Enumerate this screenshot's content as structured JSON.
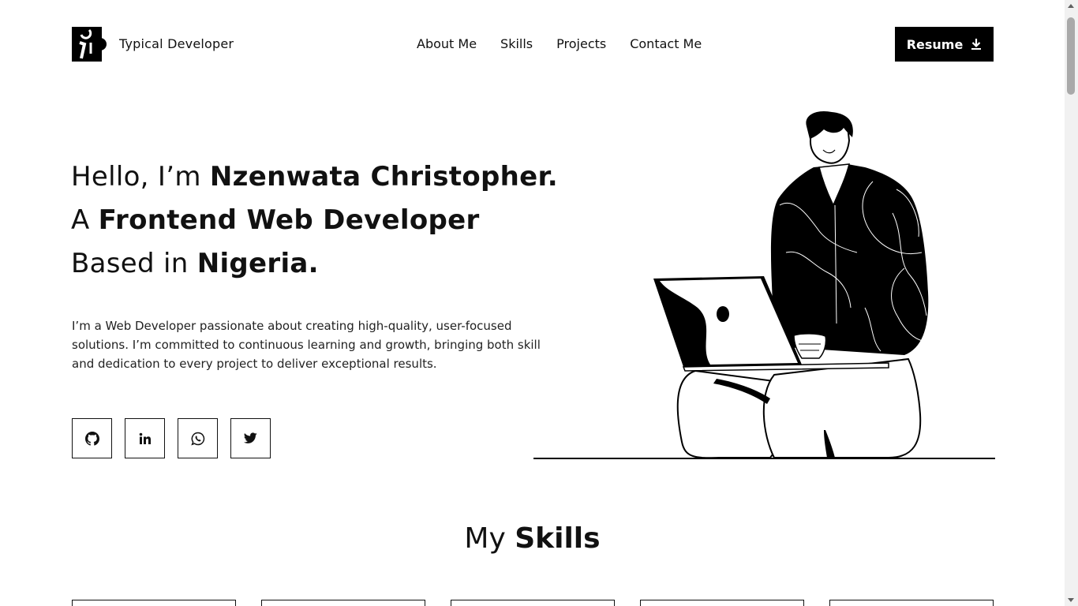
{
  "header": {
    "brand": "Typical Developer",
    "nav": [
      "About Me",
      "Skills",
      "Projects",
      "Contact Me"
    ],
    "resume_label": "Resume"
  },
  "hero": {
    "line1_pre": "Hello, I’m ",
    "line1_bold": "Nzenwata Christopher.",
    "line2_pre": "A ",
    "line2_bold": "Frontend Web Developer",
    "line3_pre": "Based in ",
    "line3_bold": "Nigeria.",
    "intro": "I’m a Web Developer passionate about creating high-quality, user-focused solutions. I’m committed to continuous learning and growth, bringing both skill and dedication to every project to deliver exceptional results."
  },
  "socials": [
    {
      "icon": "github-icon"
    },
    {
      "icon": "linkedin-icon"
    },
    {
      "icon": "whatsapp-icon"
    },
    {
      "icon": "twitter-icon"
    }
  ],
  "skills": {
    "title_pre": "My ",
    "title_bold": "Skills"
  }
}
